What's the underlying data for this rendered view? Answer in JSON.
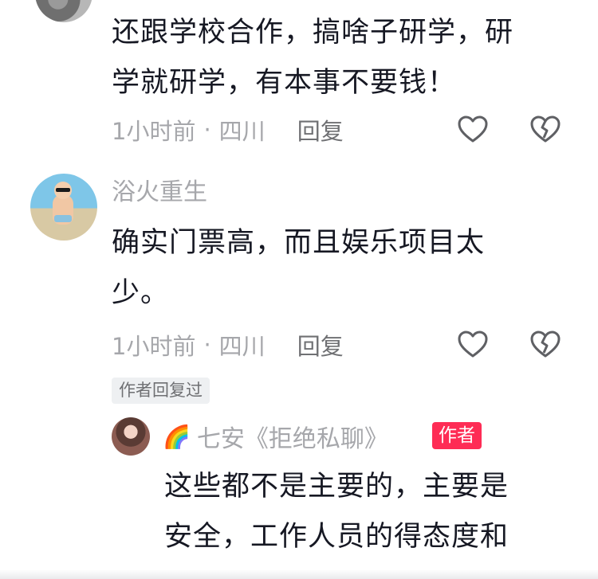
{
  "comments": [
    {
      "text_lines": [
        "还跟学校合作，搞啥子研学，研",
        "学就研学，有本事不要钱！"
      ],
      "time": "1小时前",
      "location": "四川",
      "reply_label": "回复"
    },
    {
      "username": "浴火重生",
      "text_lines": [
        "确实门票高，而且娱乐项目太",
        "少。"
      ],
      "time": "1小时前",
      "location": "四川",
      "reply_label": "回复",
      "author_replied_tag": "作者回复过"
    }
  ],
  "reply": {
    "username_emoji": "🌈",
    "username": "七安《拒绝私聊》",
    "badge": "作者",
    "text_lines": [
      "这些都不是主要的，主要是",
      "安全，工作人员的得态度和"
    ]
  },
  "separator": "·",
  "colors": {
    "badge_bg": "#fe2c55",
    "meta": "#a6a7ab",
    "text": "#161823"
  },
  "icons": [
    "heart-outline-icon",
    "broken-heart-icon"
  ]
}
